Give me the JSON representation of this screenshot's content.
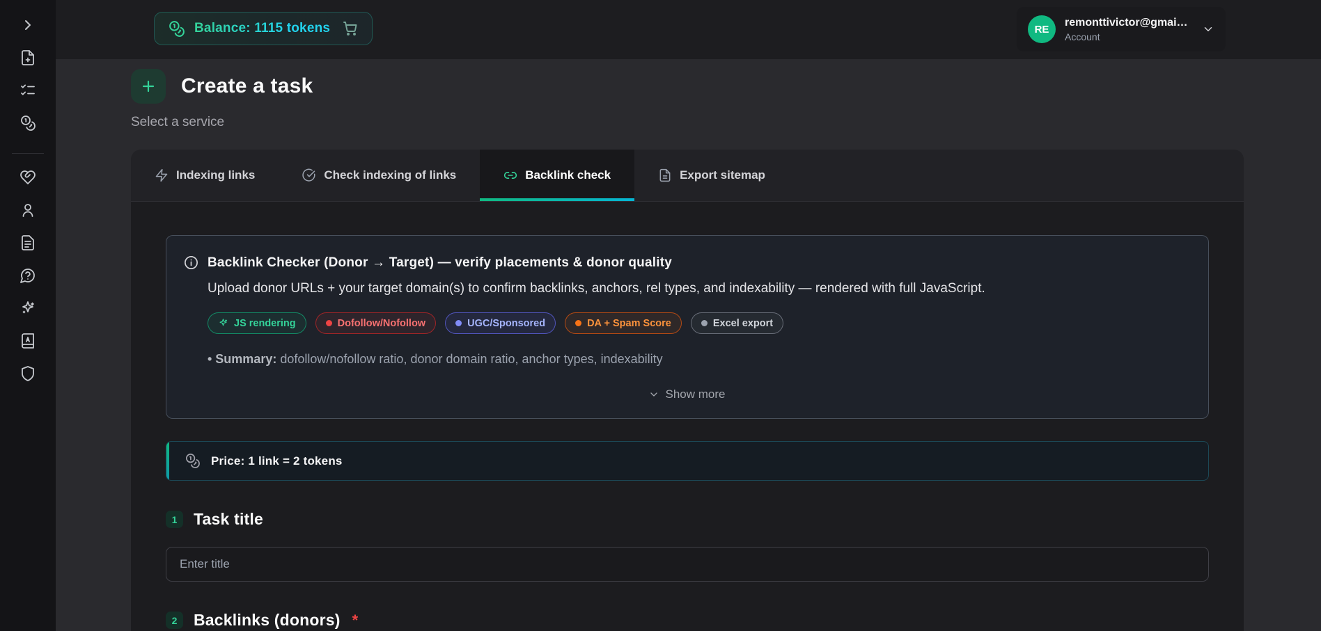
{
  "topbar": {
    "balance_label": "Balance: 1115 tokens",
    "account": {
      "initials": "RE",
      "email": "remonttivictor@gmai…",
      "label": "Account"
    }
  },
  "header": {
    "title": "Create a task",
    "subtitle": "Select a service"
  },
  "sidebar": {
    "items": [
      "chevron-right-icon",
      "file-plus-icon",
      "task-list-icon",
      "coins-icon",
      "heart-handshake-icon",
      "user-icon",
      "file-text-icon",
      "help-chat-icon",
      "sparkles-icon",
      "glossary-book-icon",
      "shield-icon"
    ]
  },
  "tabs": [
    {
      "label": "Indexing links",
      "icon": "zap-icon",
      "active": false
    },
    {
      "label": "Check indexing of links",
      "icon": "check-circle-icon",
      "active": false
    },
    {
      "label": "Backlink check",
      "icon": "link-icon",
      "active": true
    },
    {
      "label": "Export sitemap",
      "icon": "file-icon",
      "active": false
    }
  ],
  "service_info": {
    "title": "Backlink Checker (Donor → Target) — verify placements & donor quality",
    "description": "Upload donor URLs + your target domain(s) to confirm backlinks, anchors, rel types, and indexability — rendered with full JavaScript.",
    "badges": [
      {
        "label": "JS rendering",
        "color": "green"
      },
      {
        "label": "Dofollow/Nofollow",
        "color": "red"
      },
      {
        "label": "UGC/Sponsored",
        "color": "indigo"
      },
      {
        "label": "DA + Spam Score",
        "color": "orange"
      },
      {
        "label": "Excel export",
        "color": "gray"
      }
    ],
    "summary_label": "• Summary:",
    "summary_text": " dofollow/nofollow ratio, donor domain ratio, anchor types, indexability",
    "show_more_label": "Show more"
  },
  "price": {
    "label": "Price: 1 link = 2 tokens"
  },
  "sections": [
    {
      "number": "1",
      "title": "Task title"
    },
    {
      "number": "2",
      "title": "Backlinks (donors)",
      "required": "*"
    }
  ],
  "task_title_input": {
    "placeholder": "Enter title"
  },
  "colors": {
    "accent_green": "#34d399",
    "accent_cyan": "#22d3ee",
    "avatar_green": "#10b981",
    "required_red": "#ef4444",
    "badge_red": "#f87171",
    "badge_indigo": "#a5b4fc",
    "badge_orange": "#fb923c",
    "badge_gray": "#d1d5db"
  }
}
